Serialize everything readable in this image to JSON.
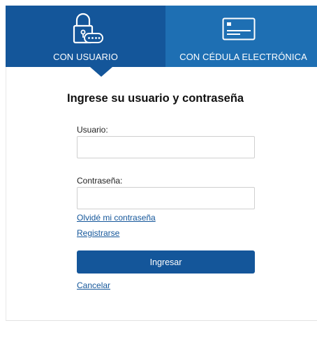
{
  "tabs": {
    "user": {
      "label": "CON USUARIO",
      "icon": "padlock-password-icon",
      "active": true
    },
    "cedula": {
      "label": "CON CÉDULA ELECTRÓNICA",
      "icon": "id-card-icon",
      "active": false
    }
  },
  "form": {
    "title": "Ingrese su usuario y contraseña",
    "username": {
      "label": "Usuario:",
      "value": "",
      "placeholder": ""
    },
    "password": {
      "label": "Contraseña:",
      "value": "",
      "placeholder": ""
    },
    "forgot_link": "Olvidé mi contraseña",
    "register_link": "Registrarse",
    "submit_label": "Ingresar",
    "cancel_link": "Cancelar"
  },
  "colors": {
    "active_tab": "#14569a",
    "inactive_tab": "#1e6fb3",
    "button": "#14569a",
    "link": "#14569a"
  }
}
